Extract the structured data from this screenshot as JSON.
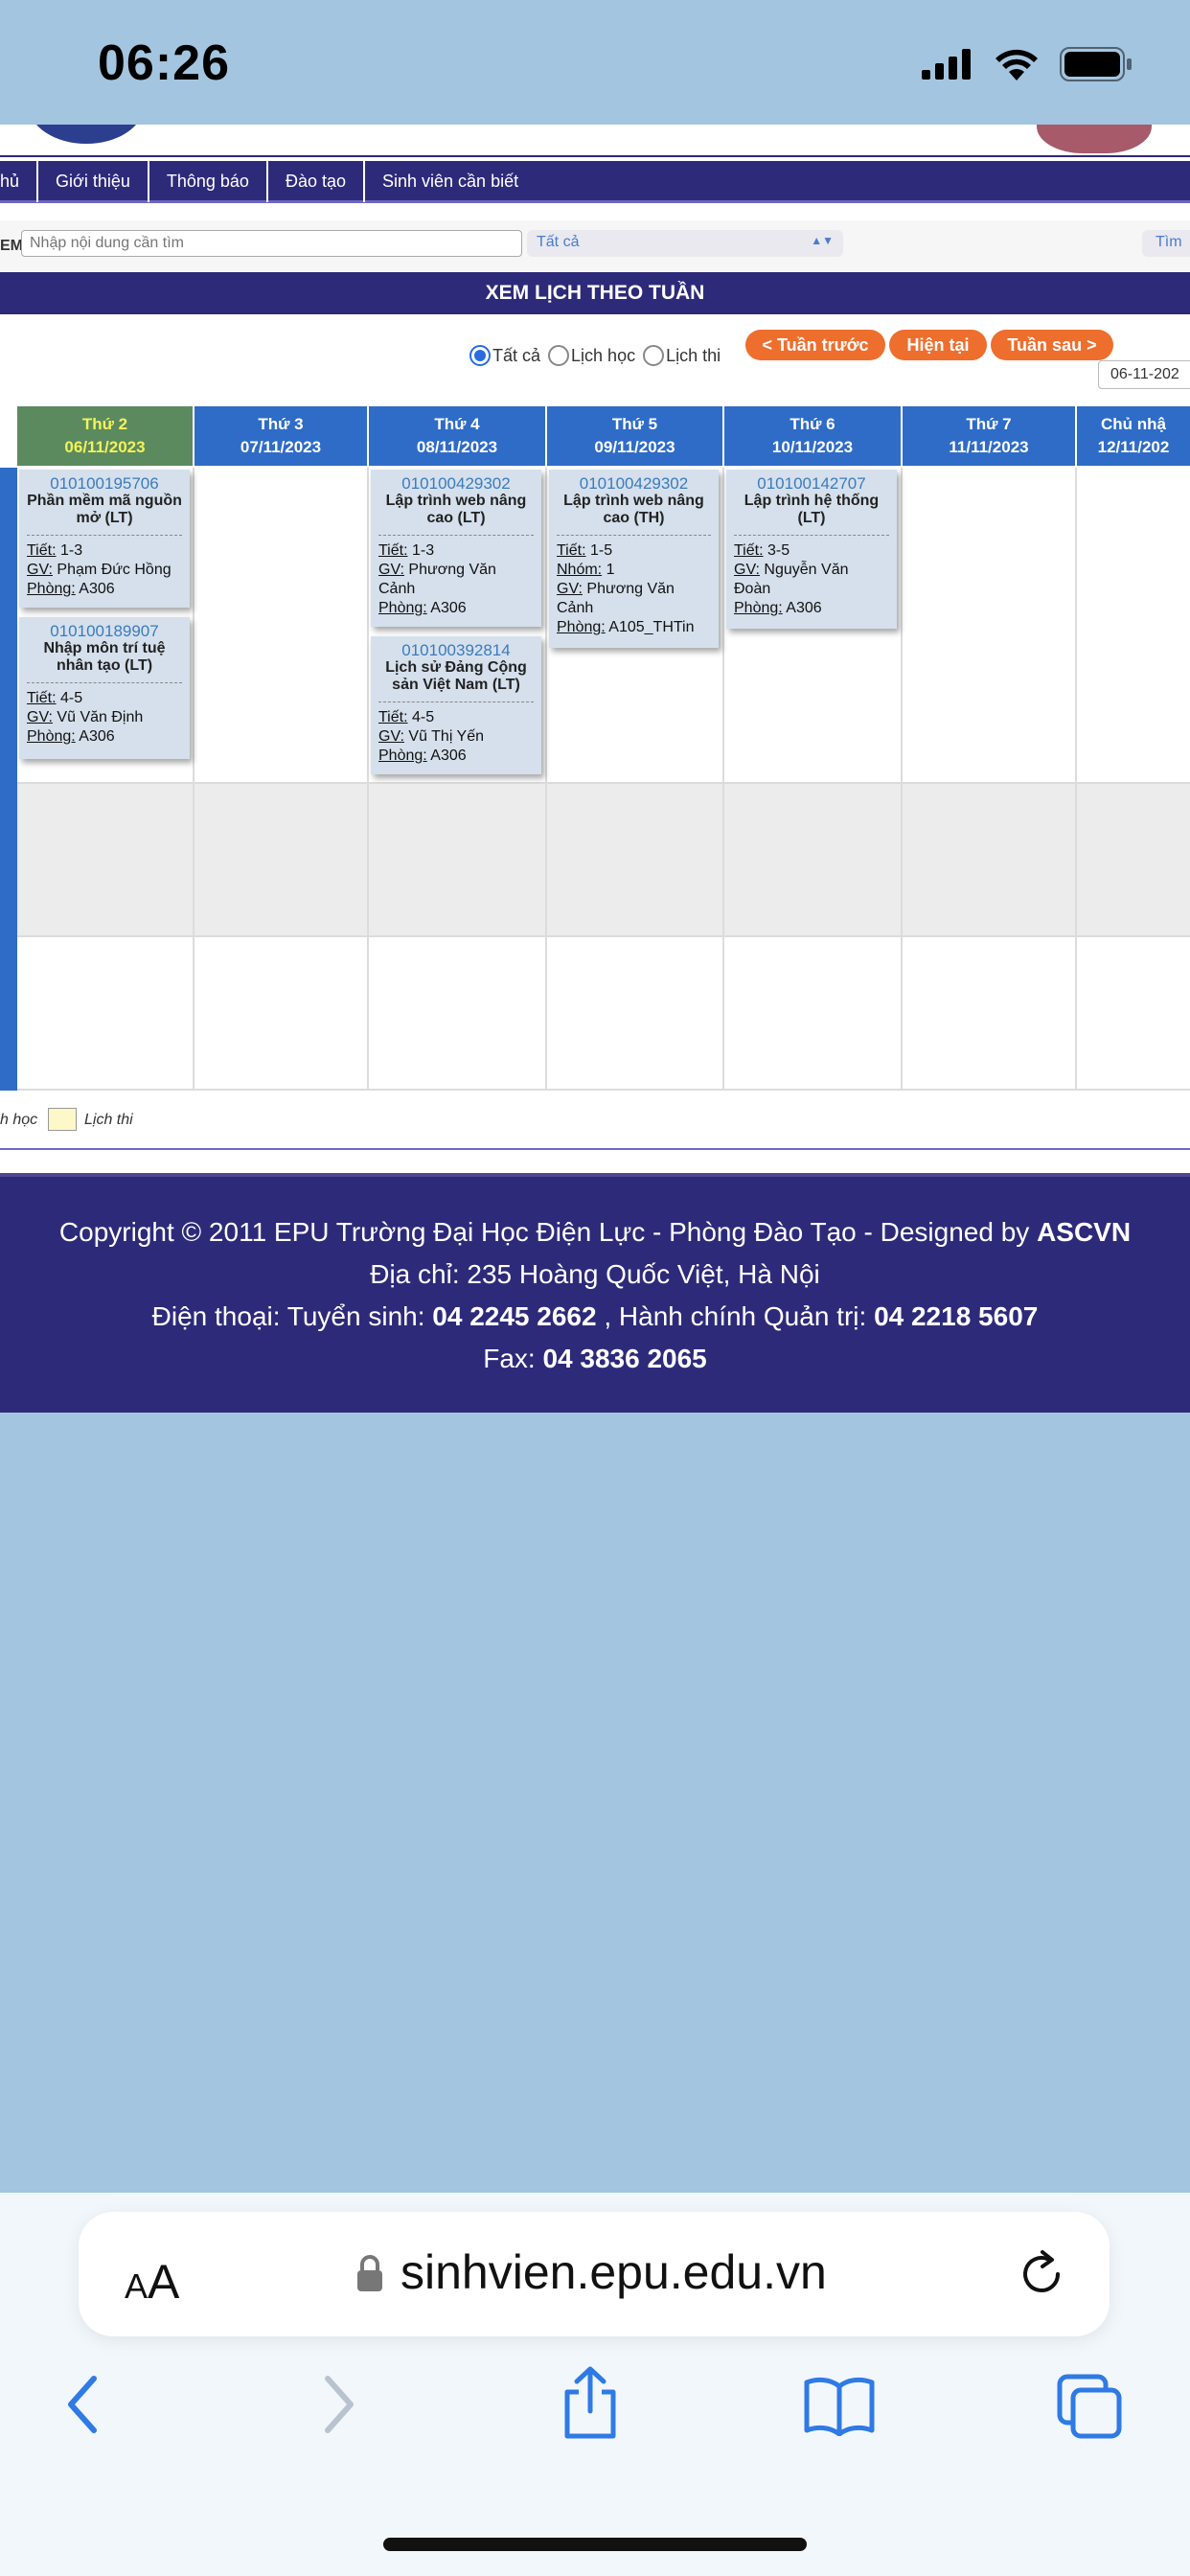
{
  "status_bar": {
    "time": "06:26"
  },
  "navbar": {
    "items": [
      "hủ",
      "Giới thiệu",
      "Thông báo",
      "Đào tạo",
      "Sinh viên cần biết"
    ]
  },
  "search": {
    "prefix": "EM",
    "placeholder": "Nhập nội dung cần tìm",
    "filter_value": "Tất cả",
    "button_label": "Tìm"
  },
  "schedule": {
    "title": "XEM LỊCH THEO TUẦN",
    "radios": [
      {
        "label": "Tất cả",
        "checked": true
      },
      {
        "label": "Lịch học",
        "checked": false
      },
      {
        "label": "Lịch thi",
        "checked": false
      }
    ],
    "prev_week": "< Tuần trước",
    "current": "Hiện tại",
    "next_week": "Tuần sau >",
    "date_value": "06-11-202",
    "days": [
      {
        "name": "Thứ 2",
        "date": "06/11/2023",
        "today": true
      },
      {
        "name": "Thứ 3",
        "date": "07/11/2023",
        "today": false
      },
      {
        "name": "Thứ 4",
        "date": "08/11/2023",
        "today": false
      },
      {
        "name": "Thứ 5",
        "date": "09/11/2023",
        "today": false
      },
      {
        "name": "Thứ 6",
        "date": "10/11/2023",
        "today": false
      },
      {
        "name": "Thứ 7",
        "date": "11/11/2023",
        "today": false
      },
      {
        "name": "Chủ nhậ",
        "date": "12/11/202",
        "today": false
      }
    ],
    "label_period": "Tiết:",
    "label_group": "Nhóm:",
    "label_teacher": "GV:",
    "label_room": "Phòng:",
    "courses": [
      {
        "code": "010100195706",
        "name": "Phần mềm mã nguồn mở (LT)",
        "period": "1-3",
        "teacher": "Phạm Đức Hồng",
        "room": "A306"
      },
      {
        "code": "010100189907",
        "name": "Nhập môn trí tuệ nhân tạo (LT)",
        "period": "4-5",
        "teacher": "Vũ Văn Định",
        "room": "A306"
      },
      {
        "code": "010100429302",
        "name": "Lập trình web nâng cao (LT)",
        "period": "1-3",
        "teacher": "Phương Văn Cảnh",
        "room": "A306"
      },
      {
        "code": "010100392814",
        "name": "Lịch sử Đảng Cộng sản Việt Nam (LT)",
        "period": "4-5",
        "teacher": "Vũ Thị Yến",
        "room": "A306"
      },
      {
        "code": "010100429302",
        "name": "Lập trình web nâng cao (TH)",
        "period": "1-5",
        "group": "1",
        "teacher": "Phương Văn Cảnh",
        "room": "A105_THTin"
      },
      {
        "code": "010100142707",
        "name": "Lập trình hệ thống (LT)",
        "period": "3-5",
        "teacher": "Nguyễn Văn Đoàn",
        "room": "A306"
      }
    ],
    "legend_study": "h học",
    "legend_exam": "Lịch thi"
  },
  "footer": {
    "line1_text": "Copyright © 2011 EPU Trường Đại Học Điện Lực - Phòng Đào Tạo - Designed by ",
    "line1_bold": "ASCVN",
    "line2": "Địa chỉ: 235 Hoàng Quốc Việt, Hà Nội",
    "line3_prefix": "Điện thoại: Tuyển sinh: ",
    "line3_phone1": "04 2245 2662",
    "line3_mid": " , Hành chính Quản trị: ",
    "line3_phone2": "04 2218 5607",
    "line4_prefix": "Fax: ",
    "line4_fax": "04 3836 2065"
  },
  "browser": {
    "aa_small": "A",
    "aa_large": "A",
    "url": "sinhvien.epu.edu.vn"
  },
  "colors": {
    "nav_purple": "#2e2a7a",
    "header_blue": "#2f6cc8",
    "today_green": "#5b8a5e",
    "button_orange": "#ee6e2e",
    "card_blue": "#d5e0ec",
    "browser_blue": "#2f7ae5"
  },
  "icons": [
    "cellular-signal-icon",
    "wifi-icon",
    "battery-icon",
    "lock-icon",
    "reload-icon",
    "back-icon",
    "forward-icon",
    "share-icon",
    "bookmarks-icon",
    "tabs-icon"
  ]
}
